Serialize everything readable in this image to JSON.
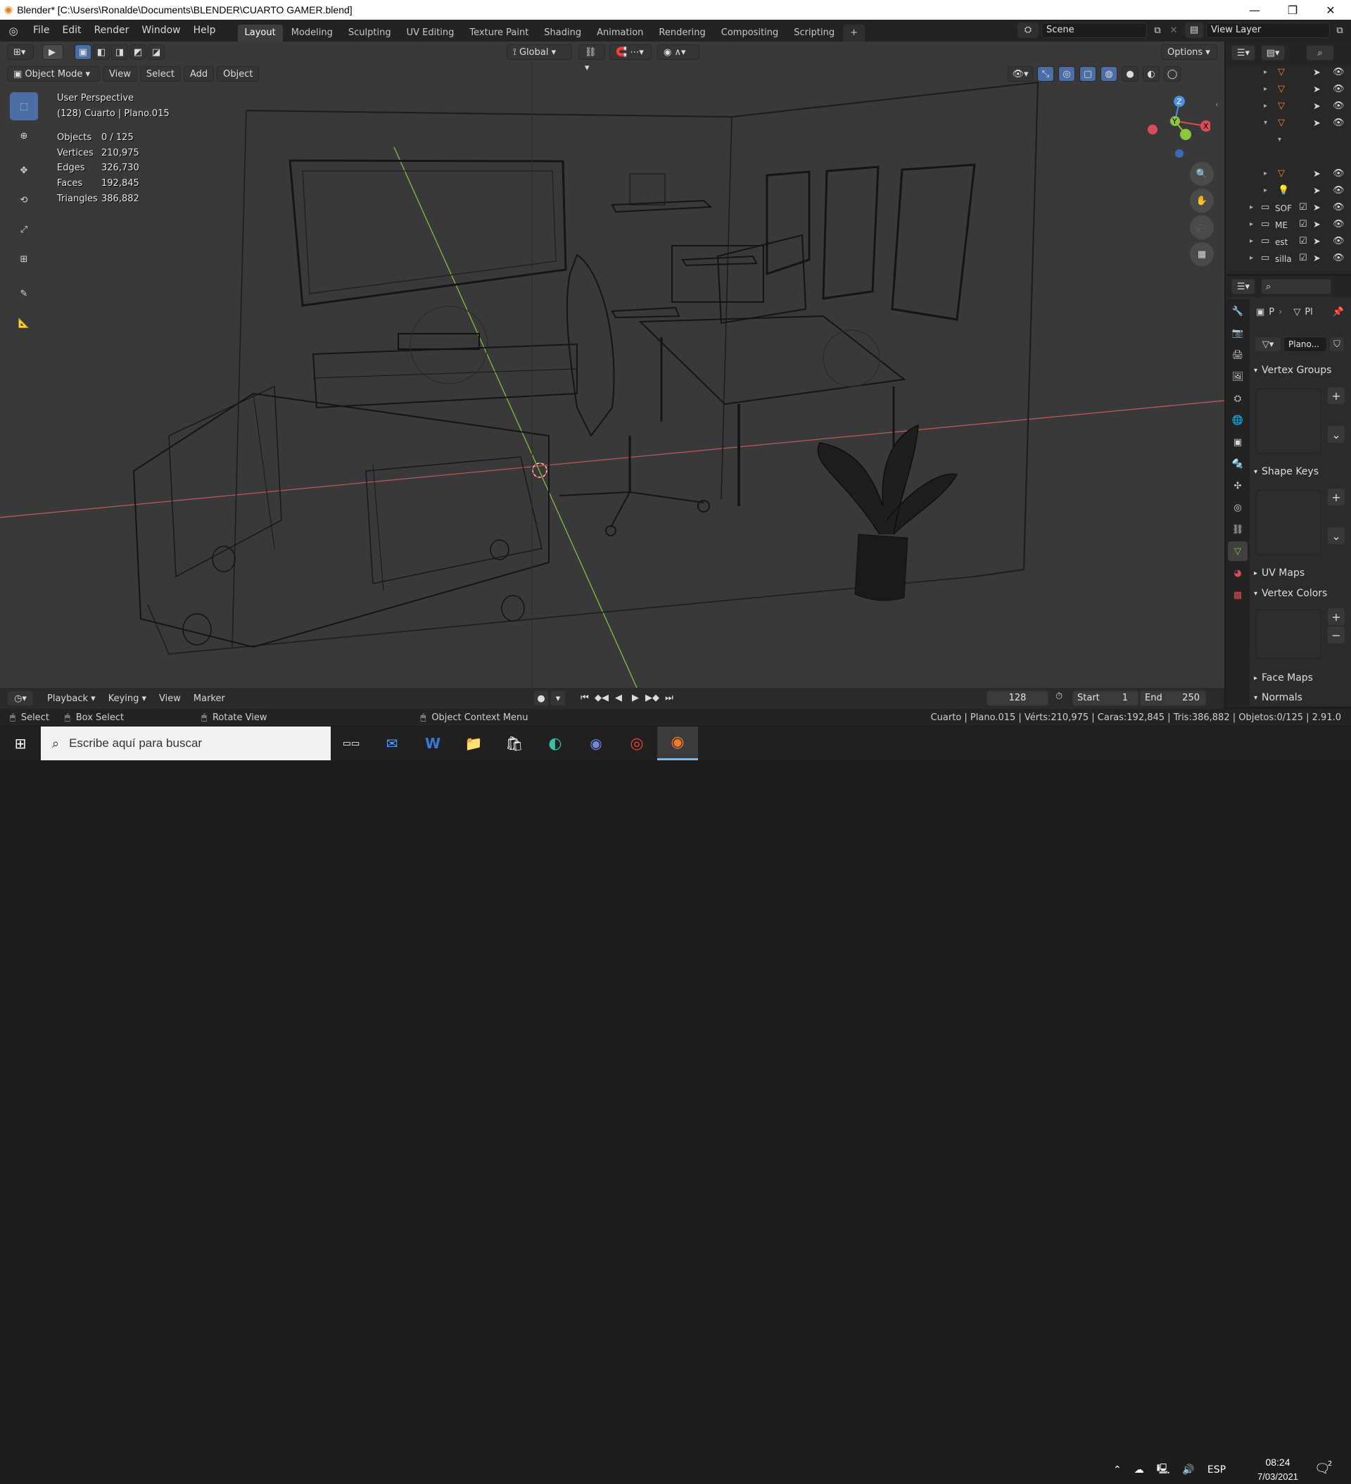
{
  "window": {
    "title": "Blender* [C:\\Users\\Ronalde\\Documents\\BLENDER\\CUARTO GAMER.blend]",
    "controls": [
      "—",
      "❐",
      "✕"
    ]
  },
  "menu": [
    "File",
    "Edit",
    "Render",
    "Window",
    "Help"
  ],
  "workspaces": [
    "Layout",
    "Modeling",
    "Sculpting",
    "UV Editing",
    "Texture Paint",
    "Shading",
    "Animation",
    "Rendering",
    "Compositing",
    "Scripting"
  ],
  "active_workspace": "Layout",
  "scene": {
    "name": "Scene",
    "view_layer": "View Layer"
  },
  "header": {
    "mode": "Object Mode",
    "menus": [
      "View",
      "Select",
      "Add",
      "Object"
    ],
    "transform_orientation": "Global",
    "options": "Options"
  },
  "viewport_info": {
    "perspective": "User Perspective",
    "context": "(128) Cuarto | Plano.015",
    "stats": [
      {
        "label": "Objects",
        "value": "0 / 125"
      },
      {
        "label": "Vertices",
        "value": "210,975"
      },
      {
        "label": "Edges",
        "value": "326,730"
      },
      {
        "label": "Faces",
        "value": "192,845"
      },
      {
        "label": "Triangles",
        "value": "386,882"
      }
    ]
  },
  "gizmo_axes": [
    "Z",
    "Y",
    "X"
  ],
  "outliner": {
    "collections": [
      "SOF",
      "ME",
      "est",
      "silla"
    ]
  },
  "properties": {
    "breadcrumb": [
      "P",
      "Pl"
    ],
    "mesh_name": "Plano...",
    "panels": [
      "Vertex Groups",
      "Shape Keys",
      "UV Maps",
      "Vertex Colors",
      "Face Maps",
      "Normals"
    ]
  },
  "timeline": {
    "menus": [
      "Playback",
      "Keying",
      "View",
      "Marker"
    ],
    "current_frame": "128",
    "start_label": "Start",
    "start": "1",
    "end_label": "End",
    "end": "250"
  },
  "statusbar": {
    "left": [
      "Select",
      "Box Select",
      "Rotate View",
      "Object Context Menu"
    ],
    "info": "Cuarto | Plano.015 | Vérts:210,975 | Caras:192,845 | Tris:386,882 | Objetos:0/125 | 2.91.0"
  },
  "taskbar": {
    "search_placeholder": "Escribe aquí para buscar",
    "lang": "ESP",
    "time": "08:24",
    "date": "7/03/2021",
    "notifications": "2"
  },
  "colors": {
    "accent": "#4b6ea5",
    "x_axis": "#d94d58",
    "y_axis": "#8cc63f",
    "z_axis": "#4d8de6",
    "ws_active": "#3d3d3d"
  }
}
